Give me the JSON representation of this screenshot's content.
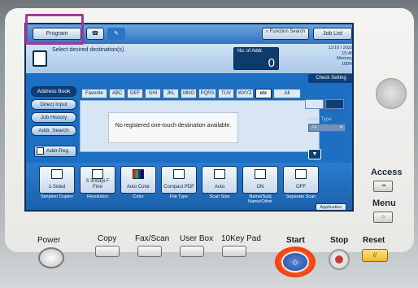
{
  "top_bar": {
    "program_label": "Program",
    "function_search_label": "Function Search",
    "job_list_label": "Job List"
  },
  "destination": {
    "prompt": "Select desired destination(s).",
    "num_label": "No. of Addr.",
    "num_value": "0"
  },
  "status": {
    "date": "11/10 / 2022",
    "time": "15:46",
    "memory_label": "Memory",
    "memory_value": "100%"
  },
  "check_setting_label": "Check Setting",
  "left_tabs": [
    "Address Book",
    "Direct Input",
    "Job History",
    "Addr. Search"
  ],
  "addr_reg_label": "Addr.Reg.",
  "index_tabs": [
    "Favorite",
    "ABC",
    "DEF",
    "GHI",
    "JKL",
    "MNO",
    "PQRS",
    "TUV",
    "WXYZ",
    "etc",
    "All"
  ],
  "empty_message": "No registered one-touch destination available.",
  "addr_type_label": "Addr. Type",
  "addr_type_value": "All",
  "settings": [
    {
      "value": "1-Sided",
      "label": "Simplex/ Duplex"
    },
    {
      "value": "S 300dpi F Fine",
      "label": "Resolution"
    },
    {
      "value": "Auto Color",
      "label": "Color"
    },
    {
      "value": "Compact PDF",
      "label": "File Type"
    },
    {
      "value": "Auto",
      "label": "Scan Size"
    },
    {
      "value": "ON",
      "label": "Name/Subj Name/Other"
    },
    {
      "value": "OFF",
      "label": "Separate Scan"
    }
  ],
  "application_label": "Application",
  "side_keys": {
    "access": "Access",
    "menu": "Menu"
  },
  "hardware": {
    "power": "Power",
    "copy": "Copy",
    "fax_scan": "Fax/Scan",
    "user_box": "User Box",
    "tenkey": "10Key Pad",
    "start": "Start",
    "stop": "Stop",
    "reset": "Reset"
  },
  "colors": {
    "screen_blue": "#1c6fc3",
    "highlight": "#a03b99",
    "start_orange": "#ff4b14"
  }
}
